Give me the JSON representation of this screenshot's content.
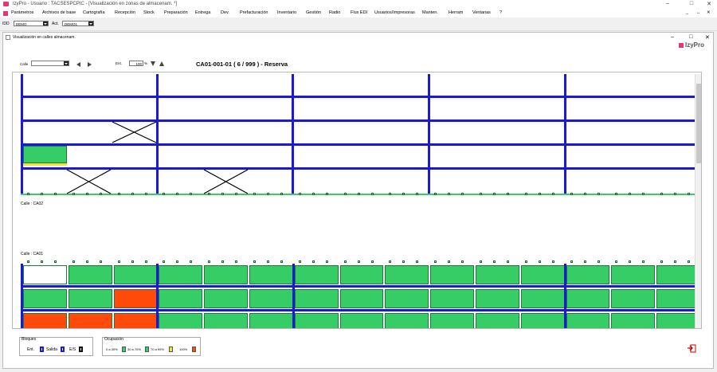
{
  "window": {
    "title": "IzyPro  -  Usuario : TACSESPCPIC - [Visualización en zonas de almacenam. *]",
    "minimize": "–",
    "maximize": "□",
    "close": "✕"
  },
  "menu": [
    "Parámetros",
    "Archivos de base",
    "Cartografía",
    "Recepción",
    "Stock",
    "Preparación",
    "Entrega",
    "Dev.",
    "Prefacturación",
    "Inventario",
    "Gestión",
    "Radio",
    "Flux EDI",
    "Usuarios/Impresoras",
    "Manten.",
    "Herram",
    "Ventanas",
    "?"
  ],
  "menu_right": [
    "_",
    "↔",
    "✕"
  ],
  "toolbar": {
    "id_label": "IDD",
    "id_value": "DEMO",
    "act_label": "Act.",
    "act_value": "DEMO1"
  },
  "child": {
    "title": "Visualización en calles almacenam.",
    "minimize": "–",
    "maximize": "□",
    "close": "✕",
    "brand": "IzyPro"
  },
  "controls": {
    "calle_label": "Calle",
    "calle_value": "",
    "ent_label": "Ent.",
    "zoom_value": "100",
    "zoom_unit": "%",
    "location": "CA01-001-01  ( 6 / 999 )  -  Reserva"
  },
  "aisles": [
    {
      "label": "Calle : CA02"
    },
    {
      "label": "Calle : CA01"
    }
  ],
  "legend": {
    "bloques_title": "Bloques",
    "bloques": [
      {
        "label": "Ent.",
        "color": "#1a1ad6"
      },
      {
        "label": "Salida",
        "color": "#1a1ad6"
      },
      {
        "label": "E/S",
        "color": "#111111"
      }
    ],
    "ocupacion_title": "Ocupación",
    "ocupacion": [
      {
        "label": "0 a 30%",
        "color": "#36cc66"
      },
      {
        "label": "30 a 70%",
        "color": "#36cc66"
      },
      {
        "label": "70 a 99%",
        "color": "#f4e23a"
      },
      {
        "label": "100%",
        "color": "#ff4a0a"
      }
    ]
  },
  "colors": {
    "rack": "#1a1ad6",
    "occupied": "#36cc66",
    "full": "#ff4a0a",
    "brand": "#e23a6f"
  }
}
